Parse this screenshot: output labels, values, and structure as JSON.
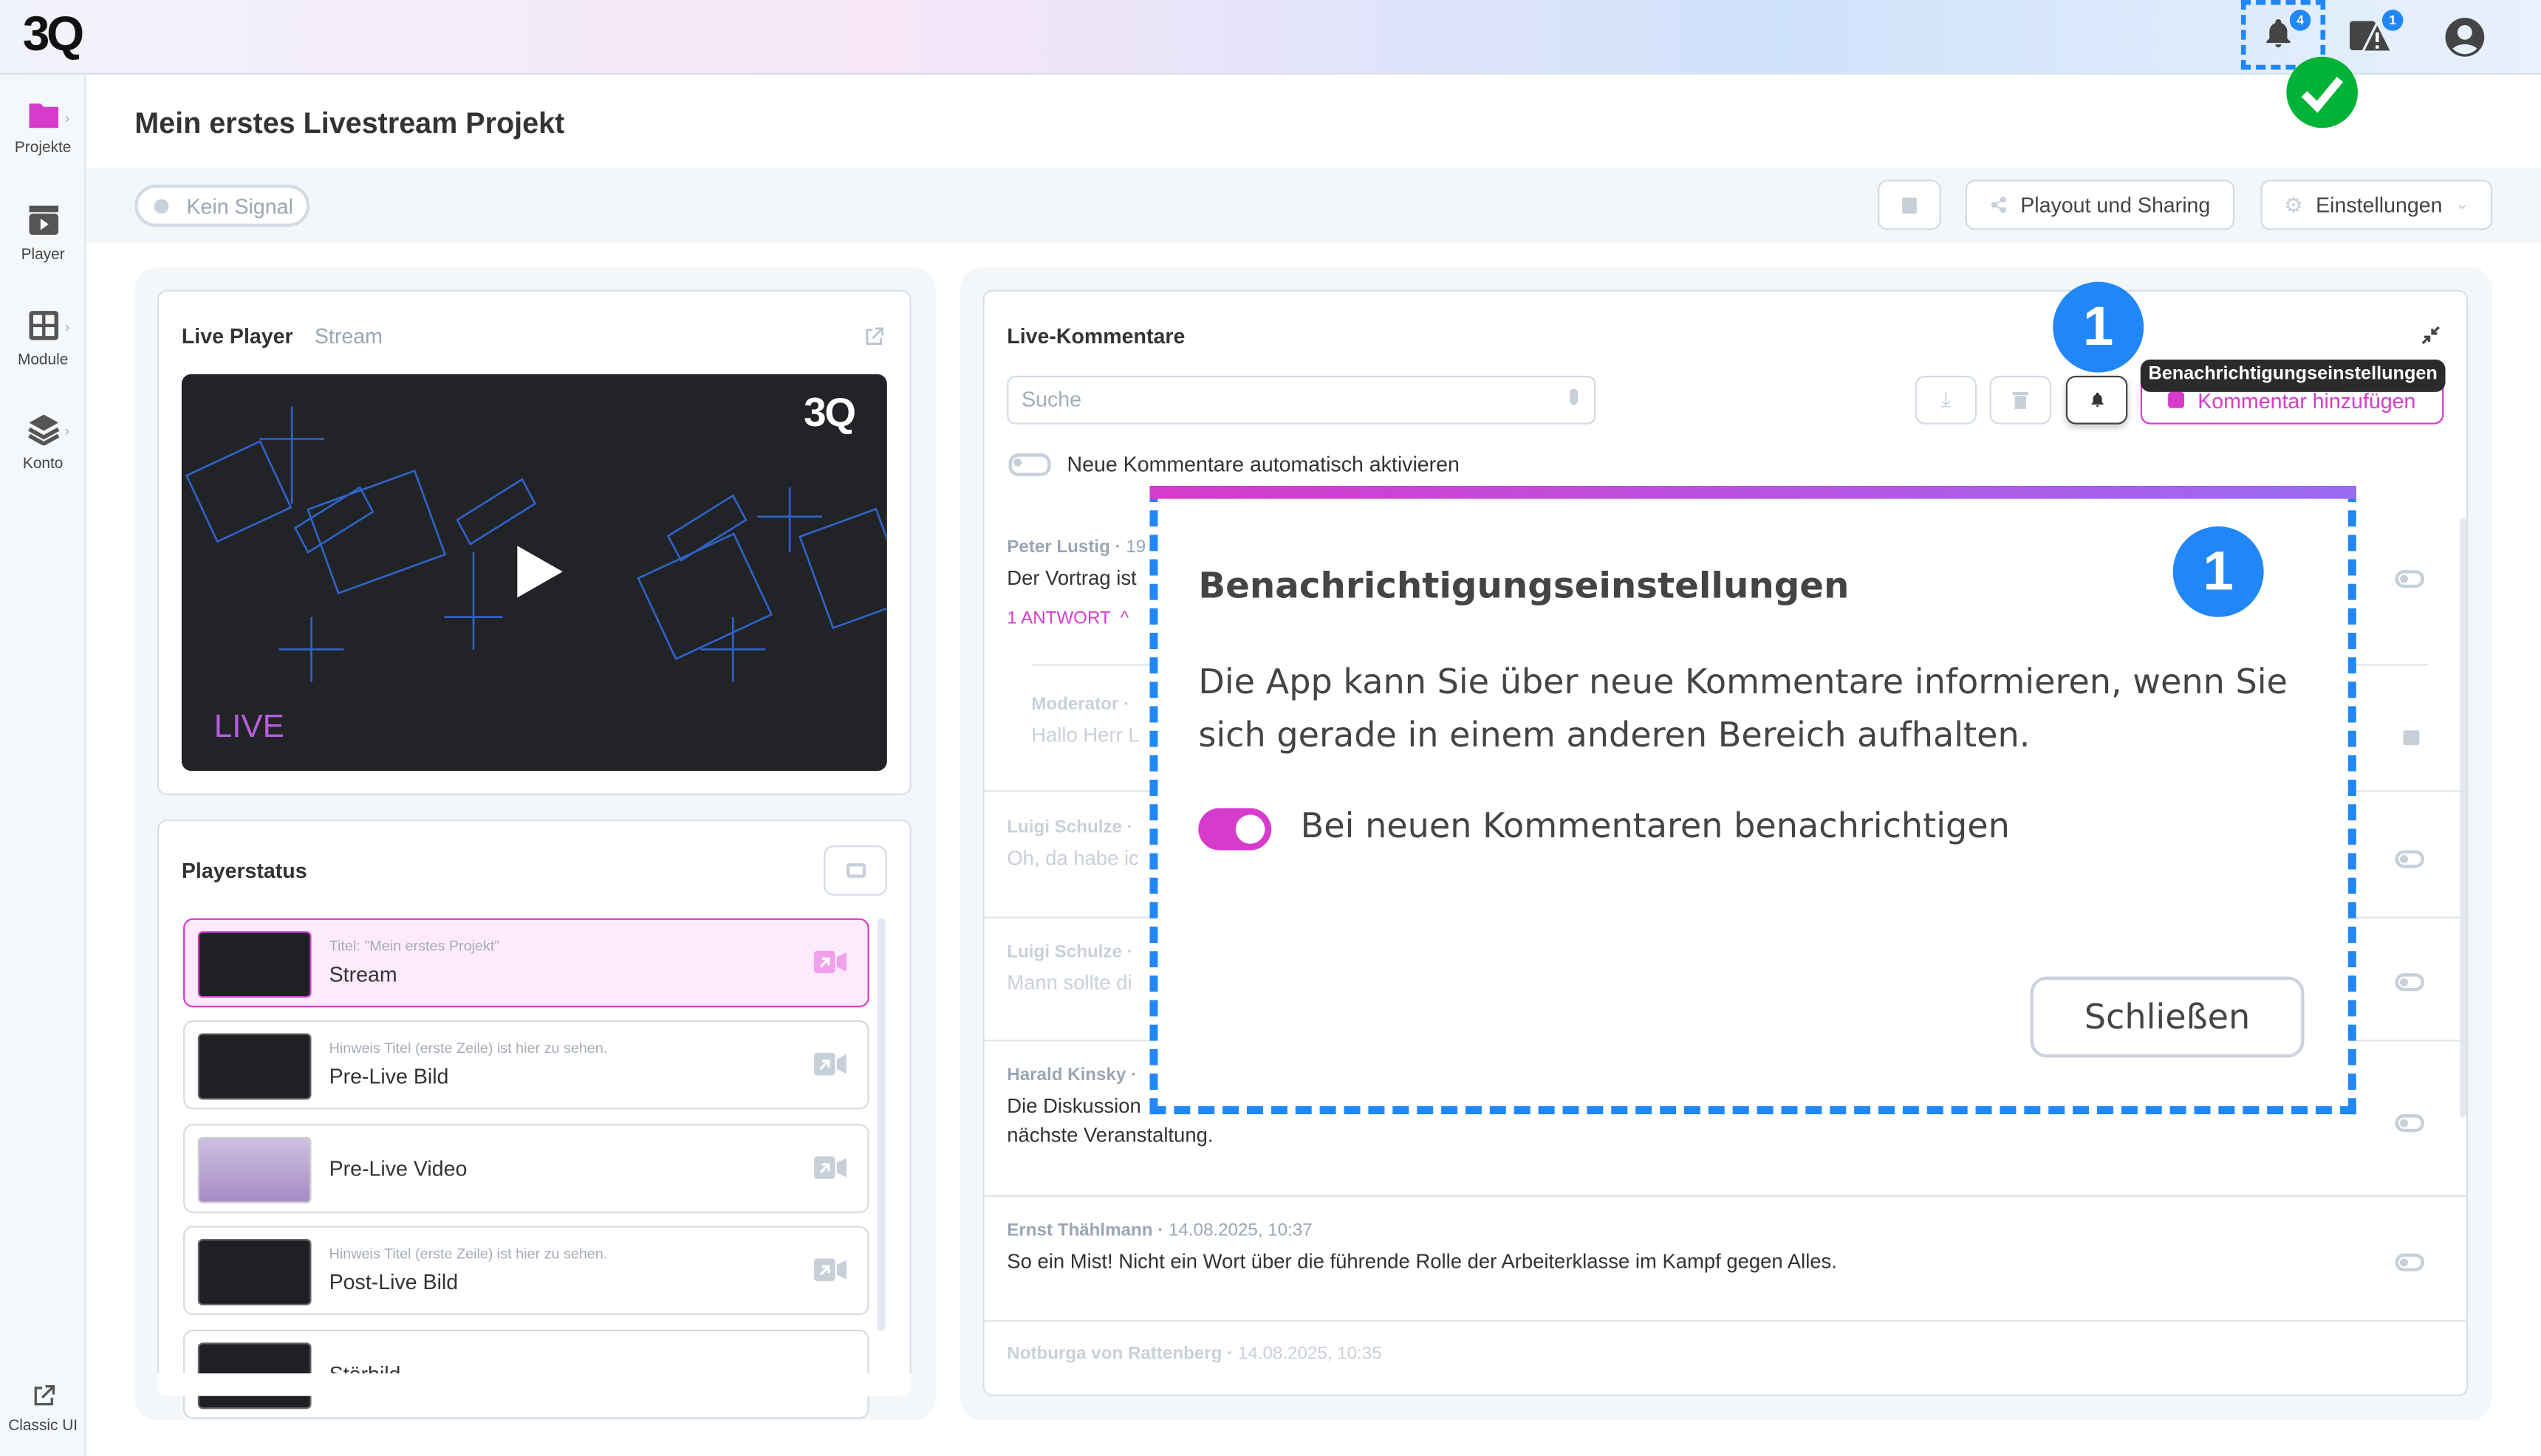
{
  "app": {
    "logo": "3Q",
    "project_title": "Mein erstes Livestream Projekt"
  },
  "header": {
    "notifications_count": "4",
    "alerts_count": "1"
  },
  "sidebar": {
    "items": [
      {
        "label": "Projekte",
        "icon": "folder-icon",
        "active": true
      },
      {
        "label": "Player",
        "icon": "clapperboard-icon"
      },
      {
        "label": "Module",
        "icon": "grid-icon"
      },
      {
        "label": "Konto",
        "icon": "layers-icon"
      }
    ],
    "classic": "Classic UI"
  },
  "toolbar": {
    "signal": "Kein Signal",
    "playout": "Playout und Sharing",
    "settings": "Einstellungen"
  },
  "live_player": {
    "title": "Live Player",
    "tab": "Stream",
    "video_logo": "3Q",
    "video_live": "LIVE"
  },
  "playerstatus": {
    "title": "Playerstatus",
    "items": [
      {
        "sub": "Titel: \"Mein erstes Projekt\"",
        "label": "Stream",
        "active": true
      },
      {
        "sub": "Hinweis Titel (erste Zeile) ist hier zu sehen.",
        "label": "Pre-Live Bild"
      },
      {
        "sub": "",
        "label": "Pre-Live Video"
      },
      {
        "sub": "Hinweis Titel (erste Zeile) ist hier zu sehen.",
        "label": "Post-Live Bild"
      },
      {
        "sub": "",
        "label": "Störbild"
      }
    ]
  },
  "comments": {
    "title": "Live-Kommentare",
    "search_placeholder": "Suche",
    "add_button": "Kommentar hinzufügen",
    "tooltip": "Benachrichtigungseinstellungen",
    "auto_activate": "Neue Kommentare automatisch aktivieren",
    "items": [
      {
        "author": "Peter Lustig",
        "time": "19",
        "text": "Der Vortrag ist",
        "replies": "1 ANTWORT"
      },
      {
        "author": "Moderator",
        "time": "",
        "text": "Hallo Herr L"
      },
      {
        "author": "Luigi Schulze",
        "time": "",
        "text": "Oh, da habe ic"
      },
      {
        "author": "Luigi Schulze",
        "time": "",
        "text": "Mann sollte di"
      },
      {
        "author": "Harald Kinsky",
        "time": "",
        "text": "Die Diskussion",
        "text2": "nächste Veranstaltung."
      },
      {
        "author": "Ernst Thählmann",
        "time": "14.08.2025, 10:37",
        "text": "So ein Mist! Nicht ein Wort über die führende Rolle der Arbeiterklasse im Kampf gegen Alles."
      },
      {
        "author": "Notburga von Rattenberg",
        "time": "14.08.2025, 10:35"
      }
    ]
  },
  "modal": {
    "title": "Benachrichtigungseinstellungen",
    "body": "Die App kann Sie über neue Kommentare informieren, wenn Sie sich gerade in einem anderen Bereich aufhalten.",
    "toggle_label": "Bei neuen Kommentaren benachrichtigen",
    "toggle_on": true,
    "close": "Schließen"
  },
  "annotations": {
    "step": "1"
  },
  "colors": {
    "accent": "#d63bcc",
    "annotation_blue": "#2187f7",
    "success": "#00b336"
  }
}
